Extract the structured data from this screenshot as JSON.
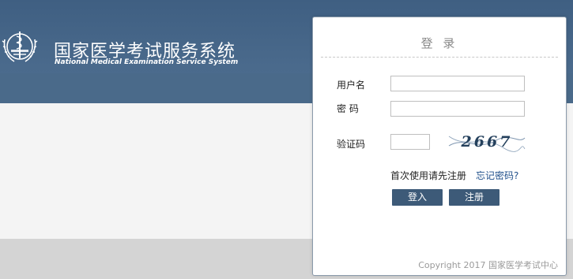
{
  "header": {
    "title_cn": "国家医学考试服务系统",
    "title_en": "National Medical Examination Service System"
  },
  "login": {
    "title": "登 录",
    "username_label": "用户名",
    "username_value": "",
    "password_label": "密 码",
    "password_value": "",
    "captcha_label": "验证码",
    "captcha_value": "",
    "captcha_text": "2667",
    "first_use": "首次使用请先注册",
    "forgot_password": "忘记密码?",
    "login_button": "登入",
    "register_button": "注册",
    "copyright": "Copyright 2017 国家医学考试中心"
  },
  "colors": {
    "header": "#435f80",
    "subbar": "#4a6a8a",
    "button": "#3d5a78",
    "link": "#1e4e8a"
  }
}
